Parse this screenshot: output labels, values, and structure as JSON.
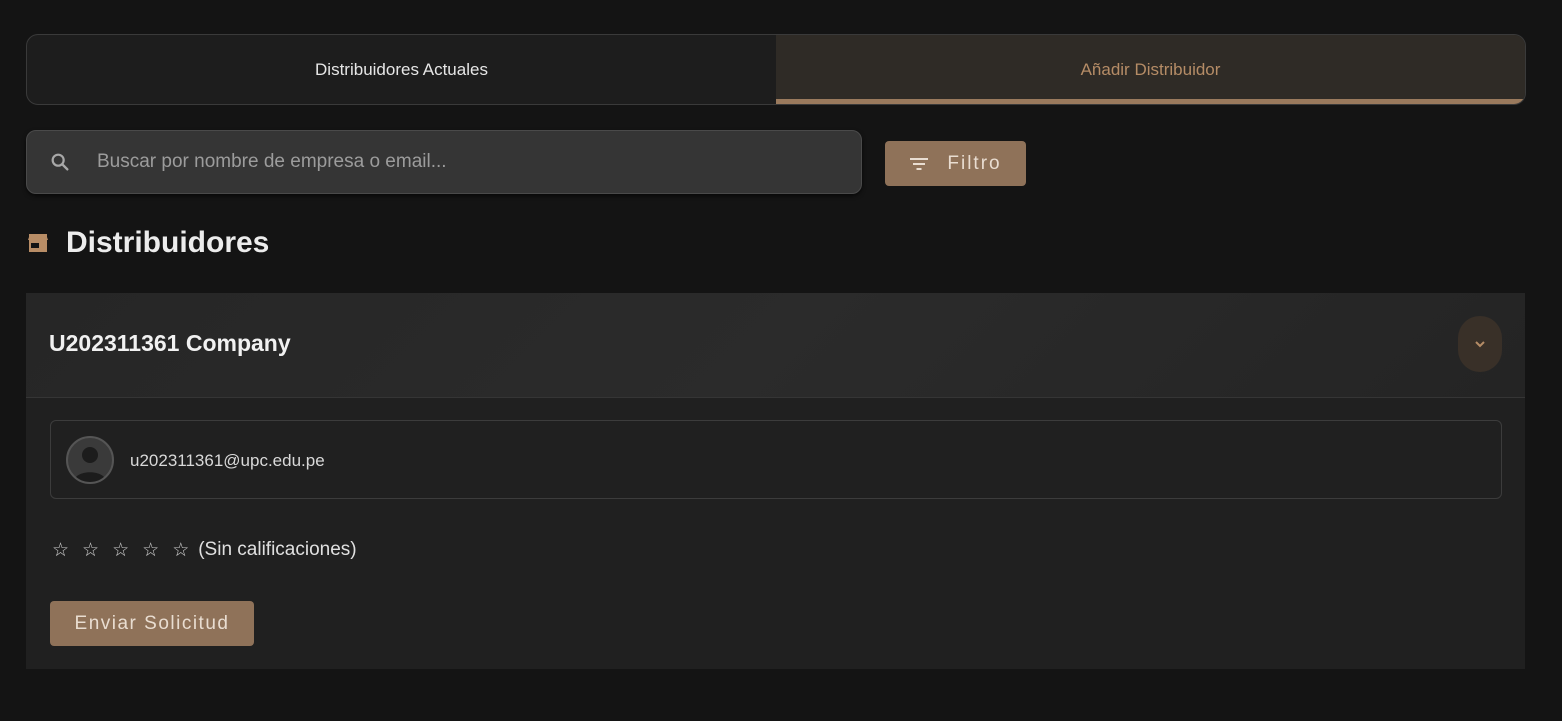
{
  "tabs": [
    {
      "label": "Distribuidores Actuales",
      "active": false
    },
    {
      "label": "Añadir Distribuidor",
      "active": true
    }
  ],
  "search": {
    "placeholder": "Buscar por nombre de empresa o email...",
    "value": "",
    "icon": "search-icon"
  },
  "filter": {
    "label": "Filtro",
    "icon": "filter-icon"
  },
  "section": {
    "icon": "store-icon",
    "title": "Distribuidores"
  },
  "distributor": {
    "company_name": "U202311361 Company",
    "email": "u202311361@upc.edu.pe",
    "rating_max": 5,
    "rating_value": 0,
    "rating_label": "(Sin calificaciones)",
    "action_label": "Enviar Solicitud",
    "expanded": true
  },
  "colors": {
    "background": "#141414",
    "accent": "#8f7259",
    "accent_text": "#b58c66",
    "card": "#202020"
  }
}
